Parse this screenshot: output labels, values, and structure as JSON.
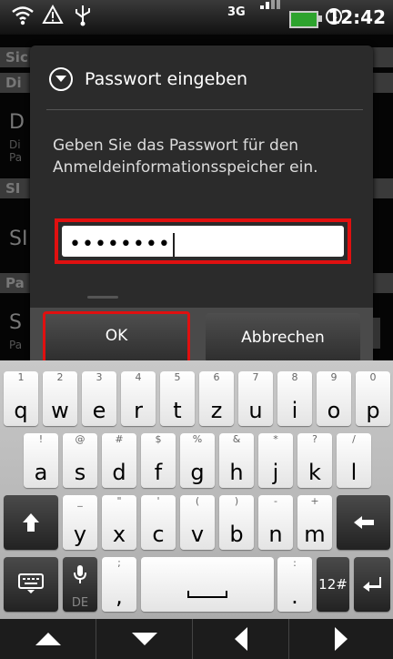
{
  "status_bar": {
    "network": "3G",
    "time": "12:42",
    "icons": [
      "wifi-icon",
      "warning-icon",
      "usb-icon",
      "signal-icon",
      "battery-charging-icon",
      "alarm-icon"
    ]
  },
  "background": {
    "header1": "Sic",
    "header2": "Di",
    "item1_title": "D",
    "item1_sub1": "Di",
    "item1_sub2": "Pa",
    "header3": "SI",
    "item2_title": "SI",
    "header4": "Pa",
    "item3_title": "S",
    "item3_sub": "Pa"
  },
  "dialog": {
    "title": "Passwort eingeben",
    "message": "Geben Sie das Passwort für den Anmeldeinformationsspeicher ein.",
    "password_value": "••••••••",
    "ok_label": "OK",
    "cancel_label": "Abbrechen"
  },
  "keyboard": {
    "row1": [
      {
        "alt": "1",
        "main": "q"
      },
      {
        "alt": "2",
        "main": "w"
      },
      {
        "alt": "3",
        "main": "e"
      },
      {
        "alt": "4",
        "main": "r"
      },
      {
        "alt": "5",
        "main": "t"
      },
      {
        "alt": "6",
        "main": "z"
      },
      {
        "alt": "7",
        "main": "u"
      },
      {
        "alt": "8",
        "main": "i"
      },
      {
        "alt": "9",
        "main": "o"
      },
      {
        "alt": "0",
        "main": "p"
      }
    ],
    "row2": [
      {
        "alt": "!",
        "main": "a"
      },
      {
        "alt": "@",
        "main": "s"
      },
      {
        "alt": "#",
        "main": "d"
      },
      {
        "alt": "$",
        "main": "f"
      },
      {
        "alt": "%",
        "main": "g"
      },
      {
        "alt": "&",
        "main": "h"
      },
      {
        "alt": "*",
        "main": "j"
      },
      {
        "alt": "?",
        "main": "k"
      },
      {
        "alt": "/",
        "main": "l"
      }
    ],
    "row3": [
      {
        "alt": "_",
        "main": "y"
      },
      {
        "alt": "\"",
        "main": "x"
      },
      {
        "alt": "'",
        "main": "c"
      },
      {
        "alt": "(",
        "main": "v"
      },
      {
        "alt": ")",
        "main": "b"
      },
      {
        "alt": "-",
        "main": "n"
      },
      {
        "alt": "+",
        "main": "m"
      }
    ],
    "row4": {
      "lang": "DE",
      "comma_alt": ";",
      "comma": ",",
      "period_alt": ":",
      "period": ".",
      "symbols_label": "12#"
    }
  }
}
